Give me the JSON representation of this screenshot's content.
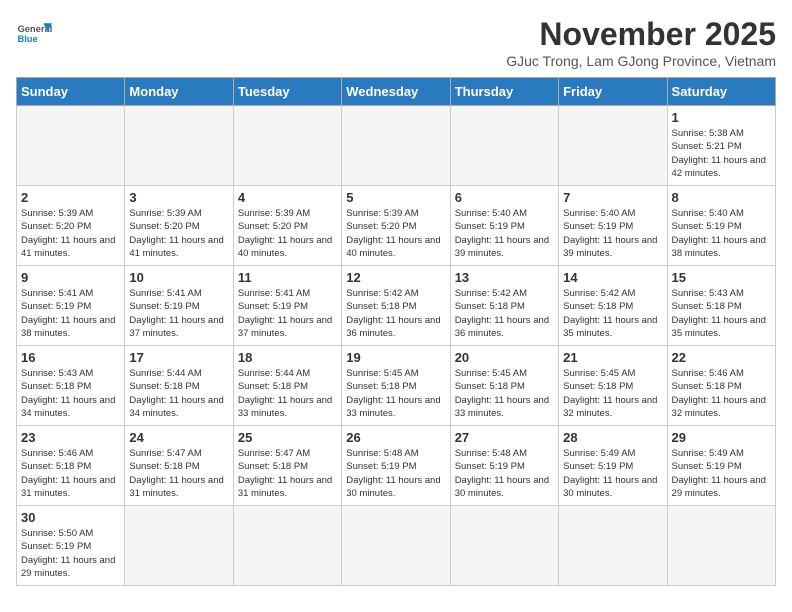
{
  "logo": {
    "line1": "General",
    "line2": "Blue"
  },
  "title": "November 2025",
  "subtitle": "GJuc Trong, Lam GJong Province, Vietnam",
  "weekdays": [
    "Sunday",
    "Monday",
    "Tuesday",
    "Wednesday",
    "Thursday",
    "Friday",
    "Saturday"
  ],
  "weeks": [
    [
      {
        "day": "",
        "info": ""
      },
      {
        "day": "",
        "info": ""
      },
      {
        "day": "",
        "info": ""
      },
      {
        "day": "",
        "info": ""
      },
      {
        "day": "",
        "info": ""
      },
      {
        "day": "",
        "info": ""
      },
      {
        "day": "1",
        "info": "Sunrise: 5:38 AM\nSunset: 5:21 PM\nDaylight: 11 hours and 42 minutes."
      }
    ],
    [
      {
        "day": "2",
        "info": "Sunrise: 5:39 AM\nSunset: 5:20 PM\nDaylight: 11 hours and 41 minutes."
      },
      {
        "day": "3",
        "info": "Sunrise: 5:39 AM\nSunset: 5:20 PM\nDaylight: 11 hours and 41 minutes."
      },
      {
        "day": "4",
        "info": "Sunrise: 5:39 AM\nSunset: 5:20 PM\nDaylight: 11 hours and 40 minutes."
      },
      {
        "day": "5",
        "info": "Sunrise: 5:39 AM\nSunset: 5:20 PM\nDaylight: 11 hours and 40 minutes."
      },
      {
        "day": "6",
        "info": "Sunrise: 5:40 AM\nSunset: 5:19 PM\nDaylight: 11 hours and 39 minutes."
      },
      {
        "day": "7",
        "info": "Sunrise: 5:40 AM\nSunset: 5:19 PM\nDaylight: 11 hours and 39 minutes."
      },
      {
        "day": "8",
        "info": "Sunrise: 5:40 AM\nSunset: 5:19 PM\nDaylight: 11 hours and 38 minutes."
      }
    ],
    [
      {
        "day": "9",
        "info": "Sunrise: 5:41 AM\nSunset: 5:19 PM\nDaylight: 11 hours and 38 minutes."
      },
      {
        "day": "10",
        "info": "Sunrise: 5:41 AM\nSunset: 5:19 PM\nDaylight: 11 hours and 37 minutes."
      },
      {
        "day": "11",
        "info": "Sunrise: 5:41 AM\nSunset: 5:19 PM\nDaylight: 11 hours and 37 minutes."
      },
      {
        "day": "12",
        "info": "Sunrise: 5:42 AM\nSunset: 5:18 PM\nDaylight: 11 hours and 36 minutes."
      },
      {
        "day": "13",
        "info": "Sunrise: 5:42 AM\nSunset: 5:18 PM\nDaylight: 11 hours and 36 minutes."
      },
      {
        "day": "14",
        "info": "Sunrise: 5:42 AM\nSunset: 5:18 PM\nDaylight: 11 hours and 35 minutes."
      },
      {
        "day": "15",
        "info": "Sunrise: 5:43 AM\nSunset: 5:18 PM\nDaylight: 11 hours and 35 minutes."
      }
    ],
    [
      {
        "day": "16",
        "info": "Sunrise: 5:43 AM\nSunset: 5:18 PM\nDaylight: 11 hours and 34 minutes."
      },
      {
        "day": "17",
        "info": "Sunrise: 5:44 AM\nSunset: 5:18 PM\nDaylight: 11 hours and 34 minutes."
      },
      {
        "day": "18",
        "info": "Sunrise: 5:44 AM\nSunset: 5:18 PM\nDaylight: 11 hours and 33 minutes."
      },
      {
        "day": "19",
        "info": "Sunrise: 5:45 AM\nSunset: 5:18 PM\nDaylight: 11 hours and 33 minutes."
      },
      {
        "day": "20",
        "info": "Sunrise: 5:45 AM\nSunset: 5:18 PM\nDaylight: 11 hours and 33 minutes."
      },
      {
        "day": "21",
        "info": "Sunrise: 5:45 AM\nSunset: 5:18 PM\nDaylight: 11 hours and 32 minutes."
      },
      {
        "day": "22",
        "info": "Sunrise: 5:46 AM\nSunset: 5:18 PM\nDaylight: 11 hours and 32 minutes."
      }
    ],
    [
      {
        "day": "23",
        "info": "Sunrise: 5:46 AM\nSunset: 5:18 PM\nDaylight: 11 hours and 31 minutes."
      },
      {
        "day": "24",
        "info": "Sunrise: 5:47 AM\nSunset: 5:18 PM\nDaylight: 11 hours and 31 minutes."
      },
      {
        "day": "25",
        "info": "Sunrise: 5:47 AM\nSunset: 5:18 PM\nDaylight: 11 hours and 31 minutes."
      },
      {
        "day": "26",
        "info": "Sunrise: 5:48 AM\nSunset: 5:19 PM\nDaylight: 11 hours and 30 minutes."
      },
      {
        "day": "27",
        "info": "Sunrise: 5:48 AM\nSunset: 5:19 PM\nDaylight: 11 hours and 30 minutes."
      },
      {
        "day": "28",
        "info": "Sunrise: 5:49 AM\nSunset: 5:19 PM\nDaylight: 11 hours and 30 minutes."
      },
      {
        "day": "29",
        "info": "Sunrise: 5:49 AM\nSunset: 5:19 PM\nDaylight: 11 hours and 29 minutes."
      }
    ],
    [
      {
        "day": "30",
        "info": "Sunrise: 5:50 AM\nSunset: 5:19 PM\nDaylight: 11 hours and 29 minutes."
      },
      {
        "day": "",
        "info": ""
      },
      {
        "day": "",
        "info": ""
      },
      {
        "day": "",
        "info": ""
      },
      {
        "day": "",
        "info": ""
      },
      {
        "day": "",
        "info": ""
      },
      {
        "day": "",
        "info": ""
      }
    ]
  ]
}
